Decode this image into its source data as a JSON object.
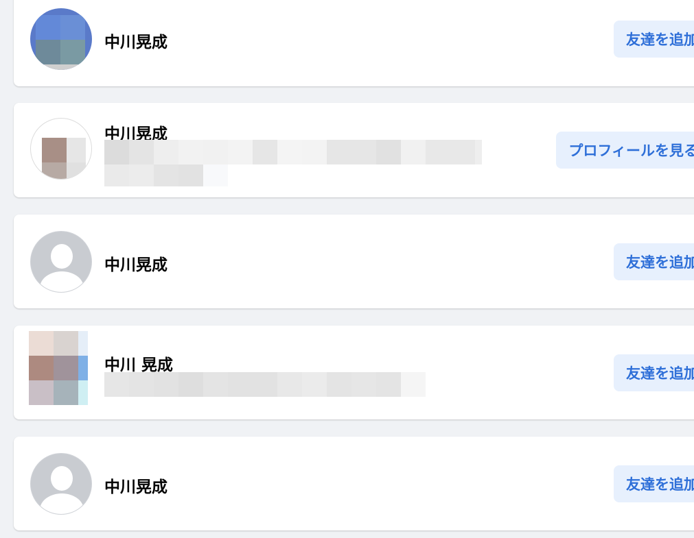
{
  "people": [
    {
      "name": "中川晃成",
      "action": "友達を追加",
      "avatar": "photo-blue"
    },
    {
      "name": "中川晃成",
      "action": "プロフィールを見る",
      "avatar": "photo-light"
    },
    {
      "name": "中川晃成",
      "action": "友達を追加",
      "avatar": "default-avatar"
    },
    {
      "name": "中川 晃成",
      "action": "友達を追加",
      "avatar": "photo-pink"
    },
    {
      "name": "中川晃成",
      "action": "友達を追加",
      "avatar": "default-avatar"
    }
  ],
  "colors": {
    "background": "#f0f2f5",
    "card": "#ffffff",
    "button_bg": "#e7f0fd",
    "button_text": "#2e6fd8"
  }
}
